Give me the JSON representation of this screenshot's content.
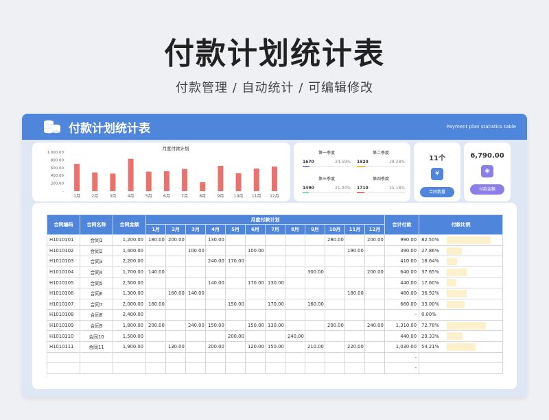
{
  "page": {
    "title": "付款计划统计表",
    "subtitle": "付款管理 / 自动统计 / 可编辑修改"
  },
  "header": {
    "title": "付款计划统计表",
    "english": "Payment plan statistics table",
    "logo_icon": "coins-stack-icon"
  },
  "chart_data": {
    "type": "bar",
    "title": "月度付款计划",
    "categories": [
      "1月",
      "2月",
      "3月",
      "4月",
      "5月",
      "6月",
      "7月",
      "8月",
      "9月",
      "10月",
      "11月",
      "12月"
    ],
    "values": [
      700,
      480,
      450,
      830,
      500,
      510,
      570,
      230,
      650,
      460,
      580,
      630
    ],
    "ylim": [
      0,
      1000
    ],
    "yticks": [
      "1,000.00",
      "800.00",
      "600.00",
      "400.00",
      "200.00",
      "-"
    ],
    "bar_color": "#e8736e"
  },
  "quarters": [
    {
      "name": "第一季度",
      "value": "1670",
      "pct": "24.59%",
      "share": 0.2459,
      "color": "#8b7ee8"
    },
    {
      "name": "第二季度",
      "value": "1920",
      "pct": "28.28%",
      "share": 0.2828,
      "color": "#f2c23a"
    },
    {
      "name": "第三季度",
      "value": "1490",
      "pct": "21.94%",
      "share": 0.2194,
      "color": "#7fd8b8"
    },
    {
      "name": "第四季度",
      "value": "1710",
      "pct": "25.18%",
      "share": 0.2518,
      "color": "#e8736e"
    }
  ],
  "stats": [
    {
      "value": "11个",
      "icon": "yuan-icon",
      "icon_glyph": "¥",
      "label": "合同数量",
      "color": "#4f86dc"
    },
    {
      "value": "6,790.00",
      "icon": "layers-icon",
      "icon_glyph": "◈",
      "label": "付款金额",
      "color": "#8b7ee8"
    }
  ],
  "table": {
    "headers": {
      "code": "合同编码",
      "name": "合同名称",
      "amount": "合同金额",
      "plan": "月度付款计划",
      "total": "合计付款",
      "ratio": "付款比例"
    },
    "months": [
      "1月",
      "2月",
      "3月",
      "4月",
      "5月",
      "6月",
      "7月",
      "8月",
      "9月",
      "10月",
      "11月",
      "12月"
    ],
    "rows": [
      {
        "code": "H1010101",
        "name": "合同1",
        "amount": "1,200.00",
        "m": [
          "180.00",
          "200.00",
          "",
          "130.00",
          "",
          "",
          "",
          "",
          "",
          "280.00",
          "",
          "200.00"
        ],
        "total": "990.00",
        "ratio": "82.50%",
        "share": 0.825
      },
      {
        "code": "H1010102",
        "name": "合同2",
        "amount": "1,400.00",
        "m": [
          "",
          "",
          "100.00",
          "",
          "",
          "100.00",
          "",
          "",
          "",
          "",
          "190.00",
          ""
        ],
        "total": "390.00",
        "ratio": "27.86%",
        "share": 0.2786
      },
      {
        "code": "H1010103",
        "name": "合同3",
        "amount": "2,200.00",
        "m": [
          "",
          "",
          "",
          "240.00",
          "170.00",
          "",
          "",
          "",
          "",
          "",
          "",
          ""
        ],
        "total": "410.00",
        "ratio": "18.64%",
        "share": 0.1864
      },
      {
        "code": "H1010104",
        "name": "合同4",
        "amount": "1,700.00",
        "m": [
          "140.00",
          "",
          "",
          "",
          "",
          "",
          "",
          "",
          "300.00",
          "",
          "",
          "200.00"
        ],
        "total": "640.00",
        "ratio": "37.65%",
        "share": 0.3765
      },
      {
        "code": "H1010105",
        "name": "合同5",
        "amount": "2,500.00",
        "m": [
          "",
          "",
          "",
          "140.00",
          "",
          "170.00",
          "130.00",
          "",
          "",
          "",
          "",
          ""
        ],
        "total": "440.00",
        "ratio": "17.60%",
        "share": 0.176
      },
      {
        "code": "H1010106",
        "name": "合同6",
        "amount": "1,300.00",
        "m": [
          "",
          "160.00",
          "140.00",
          "",
          "",
          "",
          "",
          "",
          "",
          "",
          "180.00",
          ""
        ],
        "total": "480.00",
        "ratio": "36.92%",
        "share": 0.3692
      },
      {
        "code": "H1010107",
        "name": "合同7",
        "amount": "2,000.00",
        "m": [
          "180.00",
          "",
          "",
          "",
          "150.00",
          "",
          "170.00",
          "",
          "160.00",
          "",
          "",
          ""
        ],
        "total": "660.00",
        "ratio": "33.00%",
        "share": 0.33
      },
      {
        "code": "H1010108",
        "name": "合同8",
        "amount": "2,400.00",
        "m": [
          "",
          "",
          "",
          "",
          "",
          "",
          "",
          "",
          "",
          "",
          "",
          ""
        ],
        "total": "-",
        "ratio": "0.00%",
        "share": 0
      },
      {
        "code": "H1010109",
        "name": "合同9",
        "amount": "1,800.00",
        "m": [
          "200.00",
          "",
          "240.00",
          "150.00",
          "",
          "150.00",
          "130.00",
          "",
          "",
          "200.00",
          "",
          "240.00"
        ],
        "total": "1,310.00",
        "ratio": "72.78%",
        "share": 0.7278
      },
      {
        "code": "H1010110",
        "name": "合同10",
        "amount": "1,500.00",
        "m": [
          "",
          "",
          "",
          "",
          "200.00",
          "",
          "",
          "240.00",
          "",
          "",
          "",
          ""
        ],
        "total": "440.00",
        "ratio": "29.33%",
        "share": 0.2933
      },
      {
        "code": "H1010111",
        "name": "合同11",
        "amount": "1,900.00",
        "m": [
          "",
          "130.00",
          "",
          "200.00",
          "",
          "120.00",
          "150.00",
          "",
          "210.00",
          "",
          "220.00",
          ""
        ],
        "total": "1,030.00",
        "ratio": "54.21%",
        "share": 0.5421
      },
      {
        "code": "",
        "name": "",
        "amount": "",
        "m": [
          "",
          "",
          "",
          "",
          "",
          "",
          "",
          "",
          "",
          "",
          "",
          ""
        ],
        "total": "-",
        "ratio": "",
        "share": 0
      },
      {
        "code": "",
        "name": "",
        "amount": "",
        "m": [
          "",
          "",
          "",
          "",
          "",
          "",
          "",
          "",
          "",
          "",
          "",
          ""
        ],
        "total": "-",
        "ratio": "",
        "share": 0
      }
    ]
  }
}
